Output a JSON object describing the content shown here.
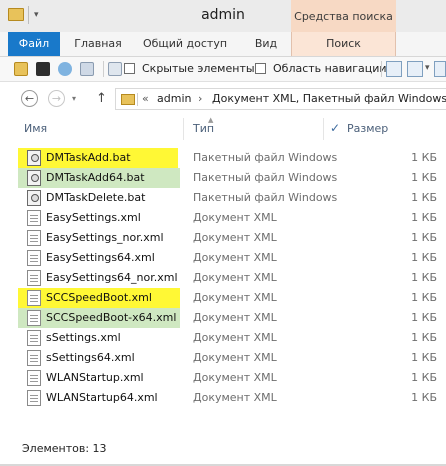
{
  "window": {
    "title": "admin"
  },
  "ribbon": {
    "contextual_header": "Средства поиска",
    "tabs": [
      {
        "label": "Файл"
      },
      {
        "label": "Главная"
      },
      {
        "label": "Общий доступ"
      },
      {
        "label": "Вид"
      },
      {
        "label": "Поиск"
      }
    ]
  },
  "toolbar": {
    "hidden_items_label": "Скрытые элементы",
    "navigation_pane_label": "Область навигации"
  },
  "address": {
    "chevron": "«",
    "crumbs": [
      "admin",
      "Документ XML, Пакетный файл Windows"
    ],
    "separator": "›"
  },
  "columns": {
    "name": "Имя",
    "type": "Тип",
    "size": "Размер"
  },
  "files": [
    {
      "name": "DMTaskAdd.bat",
      "type": "Пакетный файл Windows",
      "size": "1 КБ",
      "kind": "bat",
      "highlight": "yellow"
    },
    {
      "name": "DMTaskAdd64.bat",
      "type": "Пакетный файл Windows",
      "size": "1 КБ",
      "kind": "bat",
      "highlight": "green"
    },
    {
      "name": "DMTaskDelete.bat",
      "type": "Пакетный файл Windows",
      "size": "1 КБ",
      "kind": "bat",
      "highlight": ""
    },
    {
      "name": "EasySettings.xml",
      "type": "Документ XML",
      "size": "1 КБ",
      "kind": "xml",
      "highlight": ""
    },
    {
      "name": "EasySettings_nor.xml",
      "type": "Документ XML",
      "size": "1 КБ",
      "kind": "xml",
      "highlight": ""
    },
    {
      "name": "EasySettings64.xml",
      "type": "Документ XML",
      "size": "1 КБ",
      "kind": "xml",
      "highlight": ""
    },
    {
      "name": "EasySettings64_nor.xml",
      "type": "Документ XML",
      "size": "1 КБ",
      "kind": "xml",
      "highlight": ""
    },
    {
      "name": "SCCSpeedBoot.xml",
      "type": "Документ XML",
      "size": "1 КБ",
      "kind": "xml",
      "highlight": "yellow"
    },
    {
      "name": "SCCSpeedBoot-x64.xml",
      "type": "Документ XML",
      "size": "1 КБ",
      "kind": "xml",
      "highlight": "green"
    },
    {
      "name": "sSettings.xml",
      "type": "Документ XML",
      "size": "1 КБ",
      "kind": "xml",
      "highlight": ""
    },
    {
      "name": "sSettings64.xml",
      "type": "Документ XML",
      "size": "1 КБ",
      "kind": "xml",
      "highlight": ""
    },
    {
      "name": "WLANStartup.xml",
      "type": "Документ XML",
      "size": "1 КБ",
      "kind": "xml",
      "highlight": ""
    },
    {
      "name": "WLANStartup64.xml",
      "type": "Документ XML",
      "size": "1 КБ",
      "kind": "xml",
      "highlight": ""
    }
  ],
  "status": {
    "text": "Элементов: 13"
  },
  "colors": {
    "accent": "#1979ca",
    "highlight_yellow": "#fff835",
    "highlight_green": "#cfe8c1",
    "contextual": "#f7d9c4"
  }
}
